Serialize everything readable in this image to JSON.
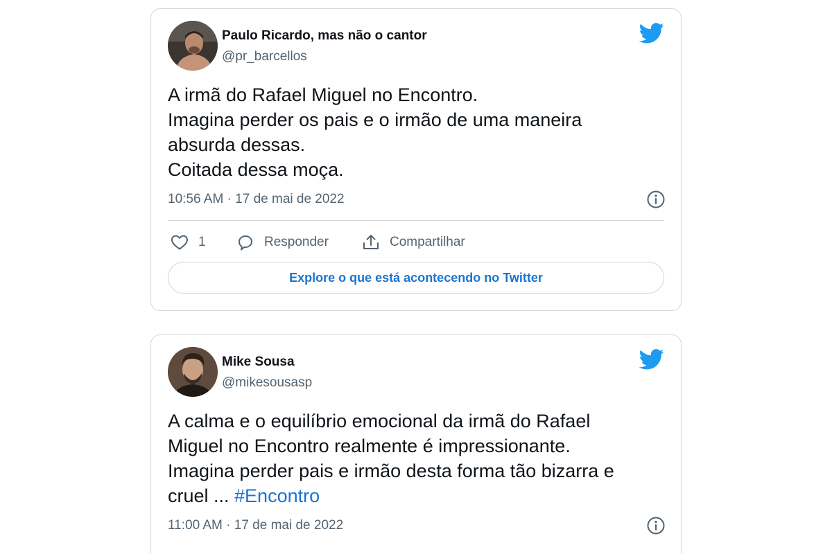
{
  "tweets": [
    {
      "author_name": "Paulo Ricardo, mas não o cantor",
      "author_handle": "@pr_barcellos",
      "text_lines": [
        "A irmã do Rafael Miguel no Encontro.",
        "Imagina perder os pais e o irmão de uma maneira",
        "absurda dessas.",
        "Coitada dessa moça."
      ],
      "timestamp": "10:56 AM · 17 de mai de 2022",
      "like_count": "1",
      "reply_label": "Responder",
      "share_label": "Compartilhar",
      "explore_label": "Explore o que está acontecendo no Twitter",
      "icons": [
        "twitter-bird",
        "info",
        "heart",
        "speech-bubble",
        "share-upload"
      ]
    },
    {
      "author_name": "Mike Sousa",
      "author_handle": "@mikesousasp",
      "text_lines": [
        "A calma e o equilíbrio emocional da irmã do Rafael",
        "Miguel no Encontro realmente é impressionante.",
        "Imagina perder pais e irmão desta forma tão bizarra e",
        "cruel ... "
      ],
      "hashtag": "#Encontro",
      "timestamp": "11:00 AM · 17 de mai de 2022",
      "icons": [
        "twitter-bird",
        "info"
      ]
    }
  ],
  "colors": {
    "twitter_blue": "#1d9bf0",
    "link_blue": "#1b74d2",
    "secondary_text": "#536471",
    "border": "#cfd9de"
  }
}
